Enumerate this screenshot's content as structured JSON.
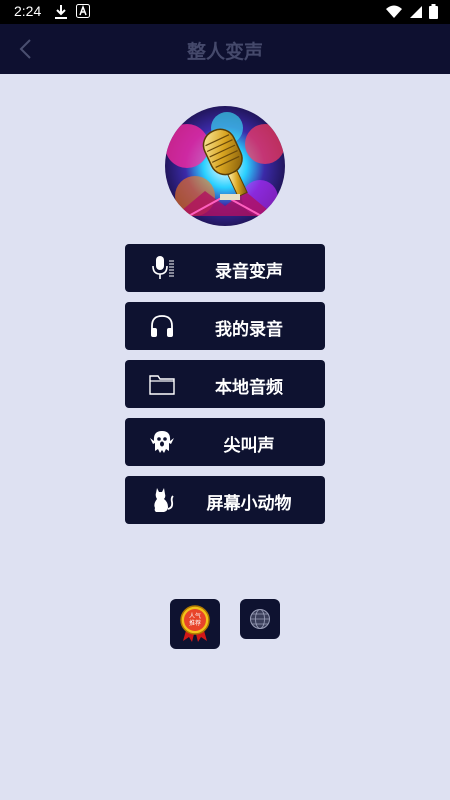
{
  "status_bar": {
    "time": "2:24"
  },
  "app_bar": {
    "title": "整人变声"
  },
  "menu": [
    {
      "label": "录音变声",
      "icon": "microphone-icon"
    },
    {
      "label": "我的录音",
      "icon": "headphones-icon"
    },
    {
      "label": "本地音频",
      "icon": "folder-icon"
    },
    {
      "label": "尖叫声",
      "icon": "ghost-icon"
    },
    {
      "label": "屏幕小动物",
      "icon": "cat-icon"
    }
  ],
  "bottom": {
    "badge_icon": "award-badge-icon",
    "badge_text_line1": "人气",
    "badge_text_line2": "推荐",
    "globe_icon": "globe-icon"
  },
  "colors": {
    "background": "#dee1f2",
    "app_bar": "#0e1030",
    "button": "#0e1230"
  }
}
